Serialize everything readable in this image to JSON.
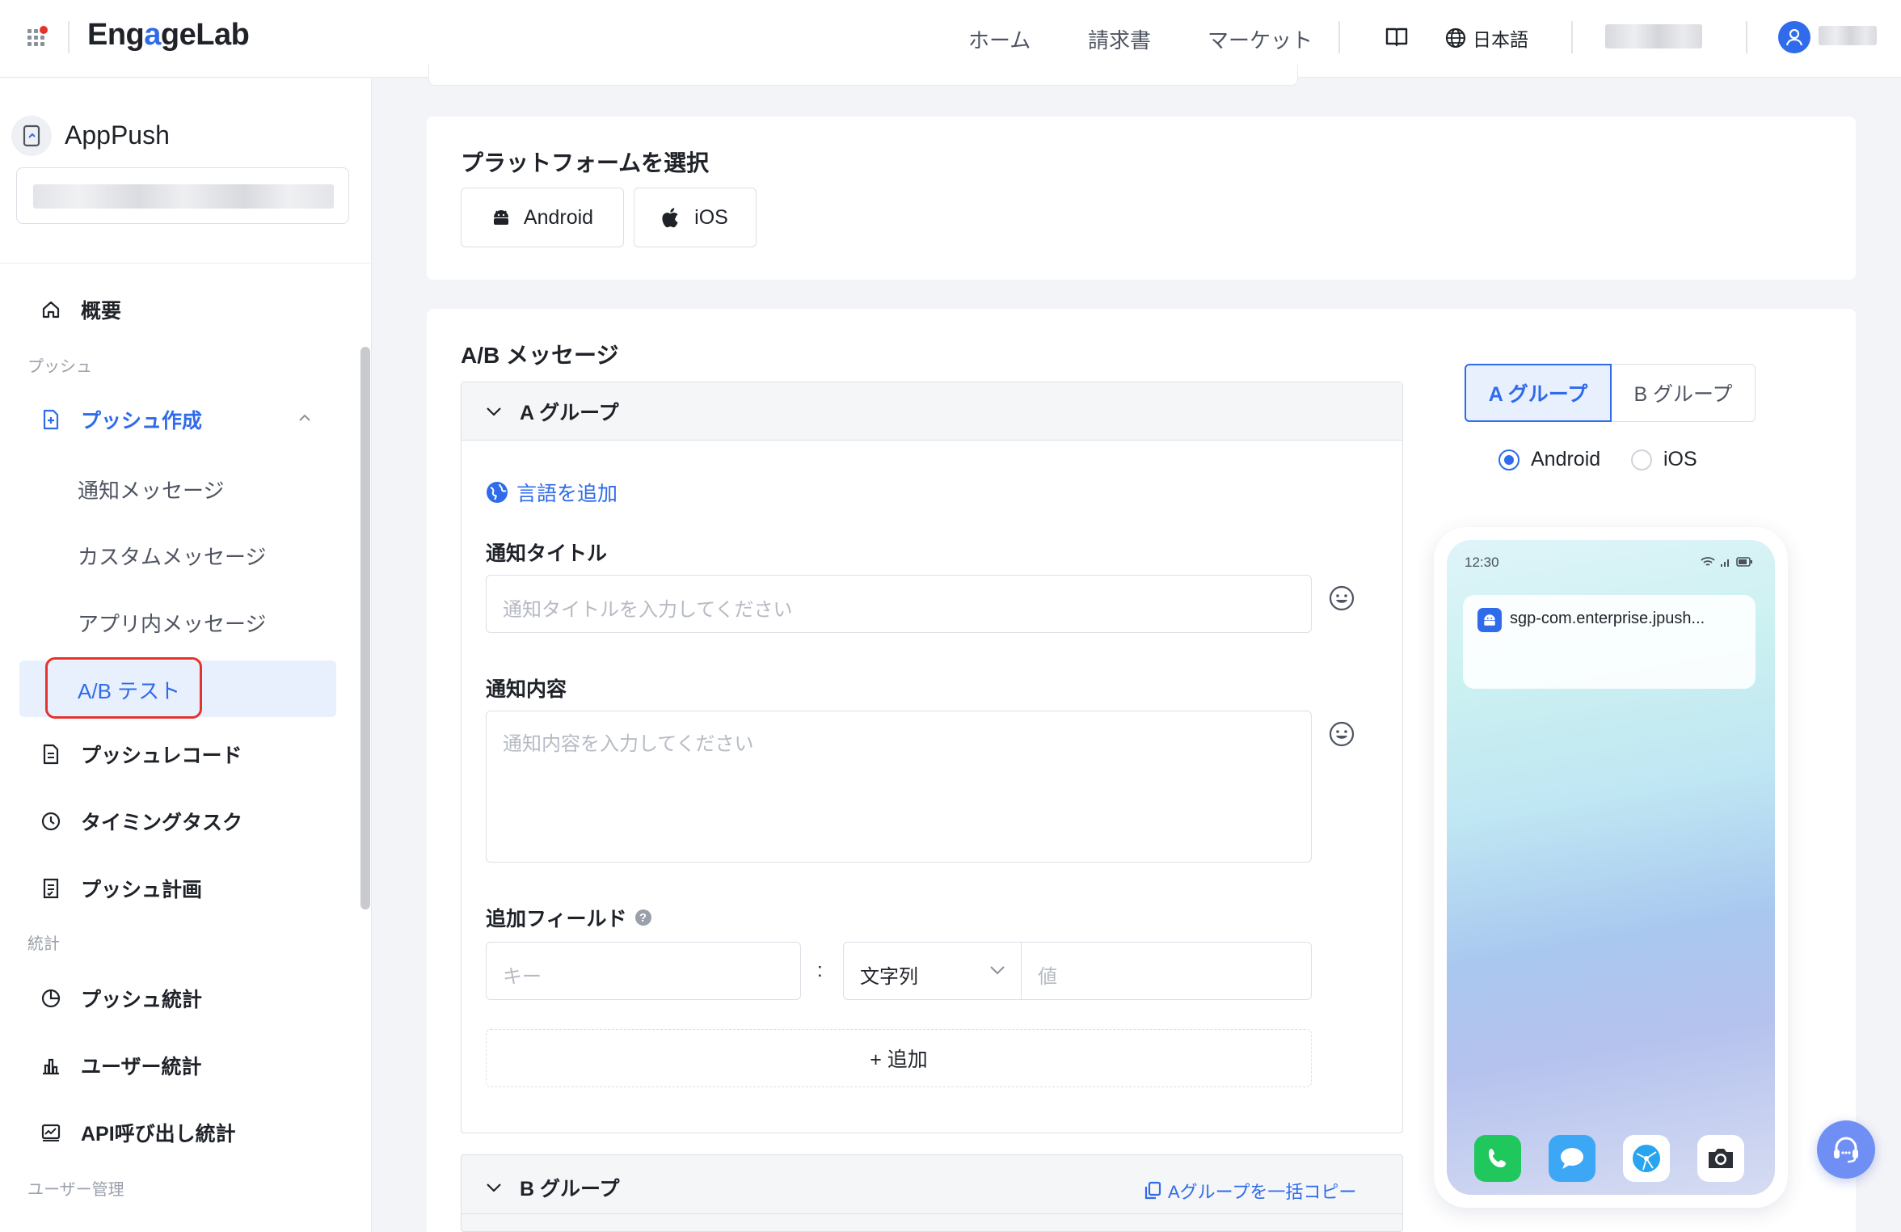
{
  "header": {
    "logo": {
      "pre": "Eng",
      "accent": "a",
      "post": "geLab"
    },
    "nav": [
      "ホーム",
      "請求書",
      "マーケット"
    ],
    "language": "日本語"
  },
  "sidebar": {
    "app_name": "AppPush",
    "items": {
      "overview": "概要",
      "section_push": "プッシュ",
      "push_create": "プッシュ作成",
      "notification_message": "通知メッセージ",
      "custom_message": "カスタムメッセージ",
      "in_app_message": "アプリ内メッセージ",
      "ab_test": "A/B テスト",
      "push_record": "プッシュレコード",
      "timing_task": "タイミングタスク",
      "push_plan": "プッシュ計画",
      "section_stats": "統計",
      "push_stats": "プッシュ統計",
      "user_stats": "ユーザー統計",
      "api_stats": "API呼び出し統計",
      "section_user": "ユーザー管理"
    }
  },
  "platform": {
    "title": "プラットフォームを選択",
    "android": "Android",
    "ios": "iOS"
  },
  "ab": {
    "title": "A/B メッセージ",
    "group_a": "A グループ",
    "group_b": "B グループ",
    "add_language": "言語を追加",
    "title_label": "通知タイトル",
    "title_placeholder": "通知タイトルを入力してください",
    "content_label": "通知内容",
    "content_placeholder": "通知内容を入力してください",
    "extra_label": "追加フィールド",
    "key_placeholder": "キー",
    "colon": ":",
    "type_value": "文字列",
    "value_placeholder": "値",
    "add_button": "+ 追加",
    "copy_a": "Aグループを一括コピー"
  },
  "preview": {
    "tab_a": "A グループ",
    "tab_b": "B グループ",
    "radio_android": "Android",
    "radio_ios": "iOS",
    "selected_radio": "Android",
    "time": "12:30",
    "notification_app": "sgp-com.enterprise.jpush..."
  },
  "colors": {
    "accent": "#2f6bea",
    "highlight_border": "#e5322d",
    "active_bg": "#e8f0fe"
  }
}
